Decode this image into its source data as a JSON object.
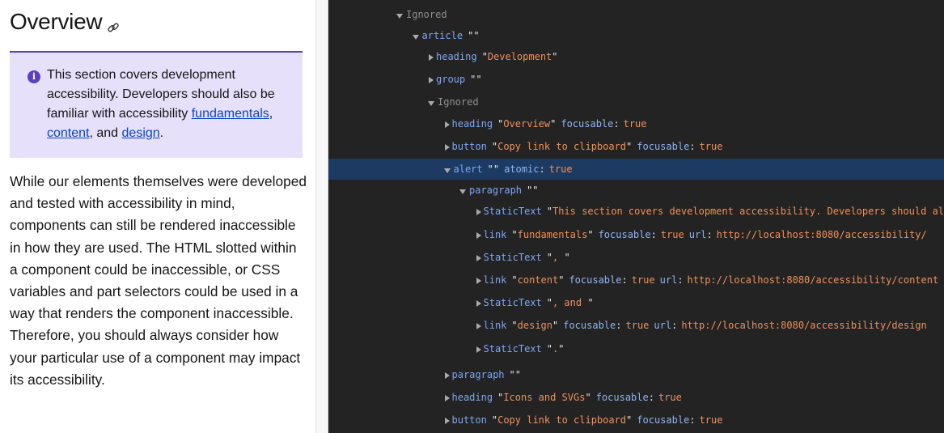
{
  "page": {
    "title": "Overview",
    "copy_link_icon": "link-icon",
    "alert": {
      "icon": "info-circle-icon",
      "text_before": "This section covers development accessibility. Developers should also be familiar with accessibility ",
      "link1": "fundamentals",
      "sep1": ", ",
      "link2": "content",
      "sep2": ", and ",
      "link3": "design",
      "end": "."
    },
    "body": "While our elements themselves were developed and tested with accessibility in mind, components can still be rendered inaccessible in how they are used. The HTML slotted within a component could be inaccessible, or CSS variables and part selectors could be used in a way that renders the component inaccessible. Therefore, you should always consider how your particular use of a component may impact its accessibility."
  },
  "colors": {
    "alert_bg": "#e6e0fb",
    "alert_border": "#5a44b8",
    "devtools_bg": "#232323",
    "selected_row": "#1d3a62",
    "role": "#7ca7f5",
    "string": "#f0905a"
  },
  "tree": [
    {
      "level": 0,
      "open": true,
      "ignored": true,
      "role": "Ignored"
    },
    {
      "level": 1,
      "open": true,
      "role": "article",
      "name": ""
    },
    {
      "level": 2,
      "open": false,
      "role": "heading",
      "name": "Development"
    },
    {
      "level": 2,
      "open": false,
      "role": "group",
      "name": ""
    },
    {
      "level": 2,
      "open": true,
      "ignored": true,
      "role": "Ignored"
    },
    {
      "level": 3,
      "open": false,
      "role": "heading",
      "name": "Overview",
      "props": [
        {
          "k": "focusable",
          "v": "true"
        }
      ]
    },
    {
      "level": 3,
      "open": false,
      "role": "button",
      "name": "Copy link to clipboard",
      "props": [
        {
          "k": "focusable",
          "v": "true"
        }
      ]
    },
    {
      "level": 3,
      "open": true,
      "selected": true,
      "role": "alert",
      "name": "",
      "props": [
        {
          "k": "atomic",
          "v": "true"
        }
      ]
    },
    {
      "level": 4,
      "open": true,
      "role": "paragraph",
      "name": ""
    },
    {
      "level": 5,
      "open": false,
      "role": "StaticText",
      "name": "This section covers development accessibility. Developers should also be familiar with accessibility "
    },
    {
      "level": 5,
      "open": false,
      "role": "link",
      "name": "fundamentals",
      "props": [
        {
          "k": "focusable",
          "v": "true"
        },
        {
          "k": "url",
          "v": "http://localhost:8080/accessibility/"
        }
      ]
    },
    {
      "level": 5,
      "open": false,
      "role": "StaticText",
      "name": ", "
    },
    {
      "level": 5,
      "open": false,
      "role": "link",
      "name": "content",
      "props": [
        {
          "k": "focusable",
          "v": "true"
        },
        {
          "k": "url",
          "v": "http://localhost:8080/accessibility/content"
        }
      ]
    },
    {
      "level": 5,
      "open": false,
      "role": "StaticText",
      "name": ", and "
    },
    {
      "level": 5,
      "open": false,
      "role": "link",
      "name": "design",
      "props": [
        {
          "k": "focusable",
          "v": "true"
        },
        {
          "k": "url",
          "v": "http://localhost:8080/accessibility/design"
        }
      ]
    },
    {
      "level": 5,
      "open": false,
      "role": "StaticText",
      "name": "."
    },
    {
      "level": 3,
      "open": false,
      "role": "paragraph",
      "name": ""
    },
    {
      "level": 3,
      "open": false,
      "role": "heading",
      "name": "Icons and SVGs",
      "props": [
        {
          "k": "focusable",
          "v": "true"
        }
      ]
    },
    {
      "level": 3,
      "open": false,
      "role": "button",
      "name": "Copy link to clipboard",
      "props": [
        {
          "k": "focusable",
          "v": "true"
        }
      ]
    }
  ]
}
